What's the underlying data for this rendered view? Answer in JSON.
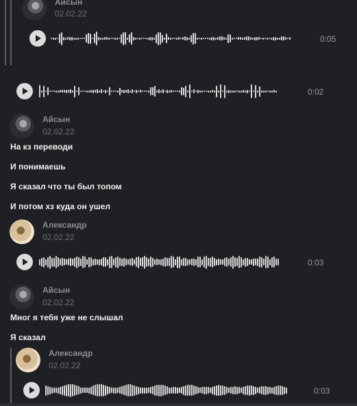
{
  "messages": [
    {
      "author": "Айсын",
      "date": "02.02.22",
      "duration": "0:05"
    },
    {
      "duration": "0:02"
    },
    {
      "author": "Айсын",
      "date": "02.02.22",
      "lines": [
        "На кз переводи",
        "И понимаешь",
        "Я сказал что ты был топом",
        "И потом хз куда он ушел"
      ]
    },
    {
      "author": "Александр",
      "date": "02.02.22",
      "duration": "0:03"
    },
    {
      "author": "Айсын",
      "date": "02.02.22",
      "lines": [
        "Мног я тебя уже не слышал",
        "Я сказал"
      ]
    },
    {
      "author": "Александр",
      "date": "02.02.22",
      "duration": "0:03"
    }
  ],
  "colors": {
    "background": "#1f2024",
    "play": "#dcdcdc",
    "wave": "#d8d8d8"
  },
  "icons": {
    "play": "play-icon"
  }
}
